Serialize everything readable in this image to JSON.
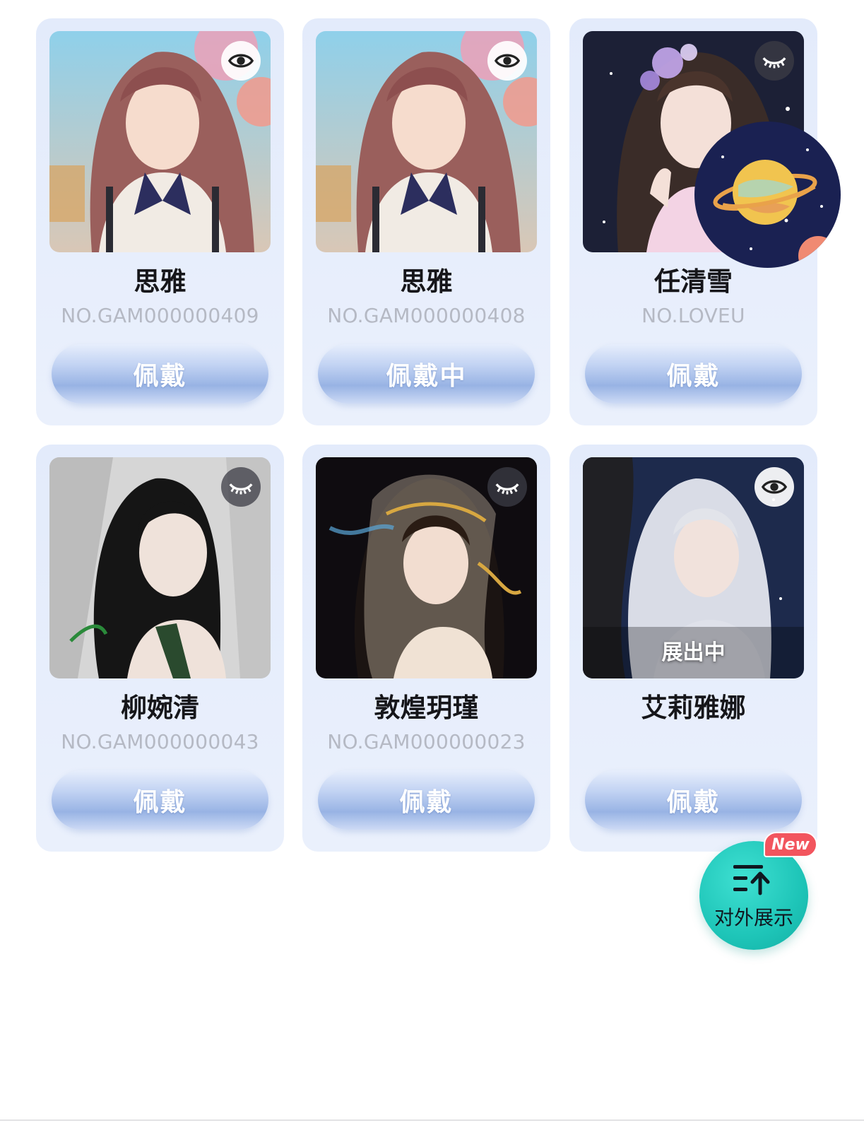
{
  "cards": [
    {
      "name": "思雅",
      "code": "NO.GAM000000409",
      "button": "佩戴",
      "visibility": "eye-open",
      "status": ""
    },
    {
      "name": "思雅",
      "code": "NO.GAM000000408",
      "button": "佩戴中",
      "visibility": "eye-open",
      "status": ""
    },
    {
      "name": "任清雪",
      "code": "NO.LOVEU",
      "button": "佩戴",
      "visibility": "eye-closed",
      "status": ""
    },
    {
      "name": "柳婉清",
      "code": "NO.GAM000000043",
      "button": "佩戴",
      "visibility": "eye-closed",
      "status": ""
    },
    {
      "name": "敦煌玥瑾",
      "code": "NO.GAM000000023",
      "button": "佩戴",
      "visibility": "eye-closed",
      "status": ""
    },
    {
      "name": "艾莉雅娜",
      "code": "",
      "button": "佩戴",
      "visibility": "eye-open",
      "status": "展出中"
    }
  ],
  "fab": {
    "label": "对外展示",
    "badge": "New",
    "icon": "sort-up-icon"
  },
  "colors": {
    "card_bg": "#e5ecfb",
    "button": "#9fb8e6",
    "fab": "#1ec5b8",
    "badge": "#f2555e",
    "name_text": "#16161a",
    "code_text": "#b5b9c4"
  }
}
